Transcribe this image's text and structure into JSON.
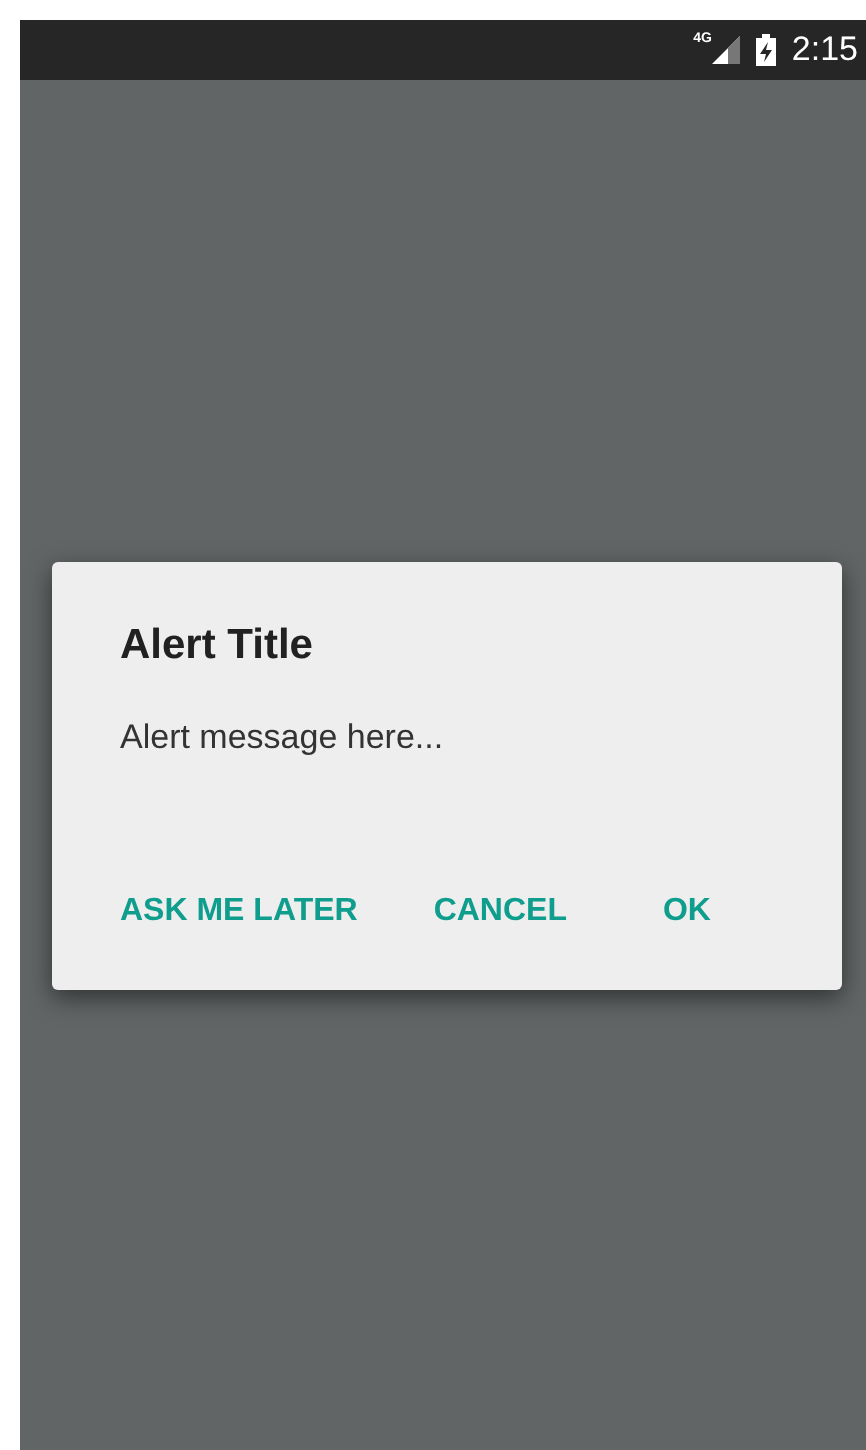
{
  "status_bar": {
    "network": "4G",
    "time": "2:15"
  },
  "dialog": {
    "title": "Alert Title",
    "message": "Alert message here...",
    "buttons": [
      {
        "label": "ASK ME LATER"
      },
      {
        "label": "CANCEL"
      },
      {
        "label": "OK"
      }
    ]
  }
}
